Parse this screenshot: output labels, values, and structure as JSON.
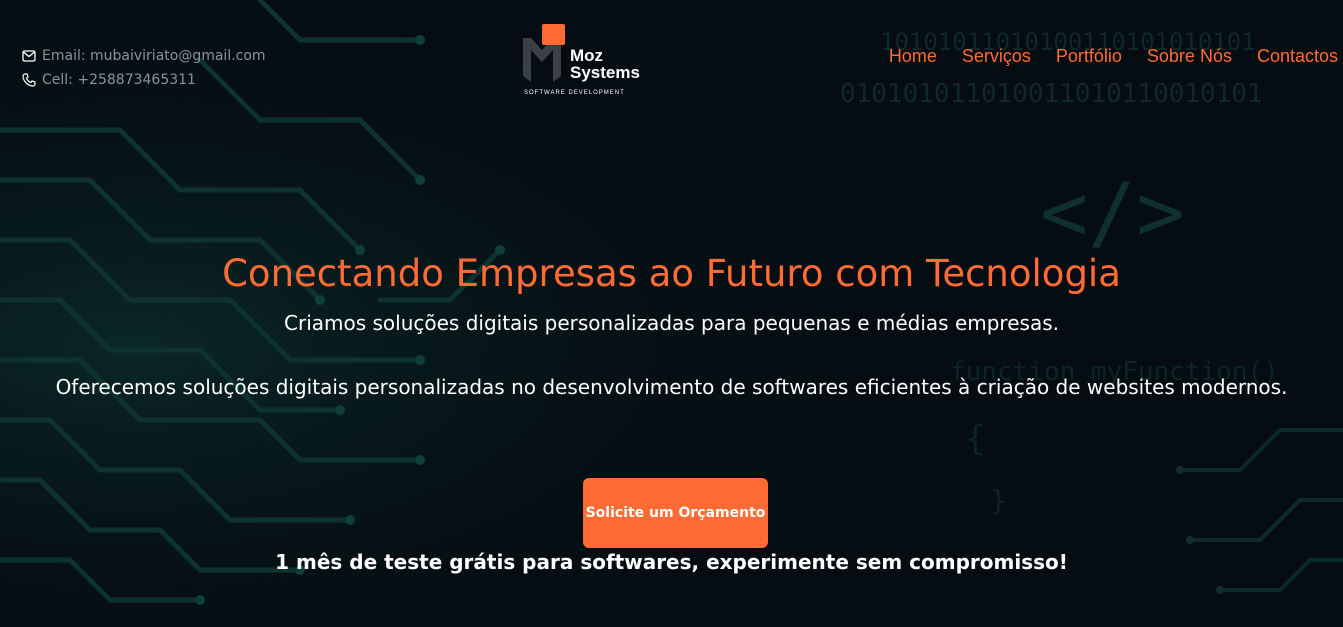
{
  "contact": {
    "email": "Email: mubaiviriato@gmail.com",
    "cell": "Cell: +258873465311"
  },
  "logo": {
    "line1": "Moz",
    "line2": "Systems",
    "tagline": "SOFTWARE DEVELOPMENT"
  },
  "nav": {
    "items": [
      "Home",
      "Serviços",
      "Portfólio",
      "Sobre Nós",
      "Contactos"
    ]
  },
  "hero": {
    "title": "Conectando Empresas ao Futuro com Tecnologia",
    "subtitle": "Criamos soluções digitais personalizadas para pequenas e médias empresas.",
    "description": "Oferecemos soluções digitais personalizadas no desenvolvimento de softwares eficientes à criação de websites modernos.",
    "cta_label": "Solicite um Orçamento",
    "trial_note": "1 mês de teste grátis para softwares, experimente sem compromisso!"
  },
  "background": {
    "binary_line1": "10101011010100110101010101",
    "binary_line2": "010101011010011010110010101",
    "code_tag": "</>",
    "code_function": "function myFunction()",
    "code_brace": "{",
    "code_brace_close": "}"
  },
  "colors": {
    "accent": "#ff6b35",
    "background": "#050d12",
    "circuit": "#0f3a33"
  }
}
